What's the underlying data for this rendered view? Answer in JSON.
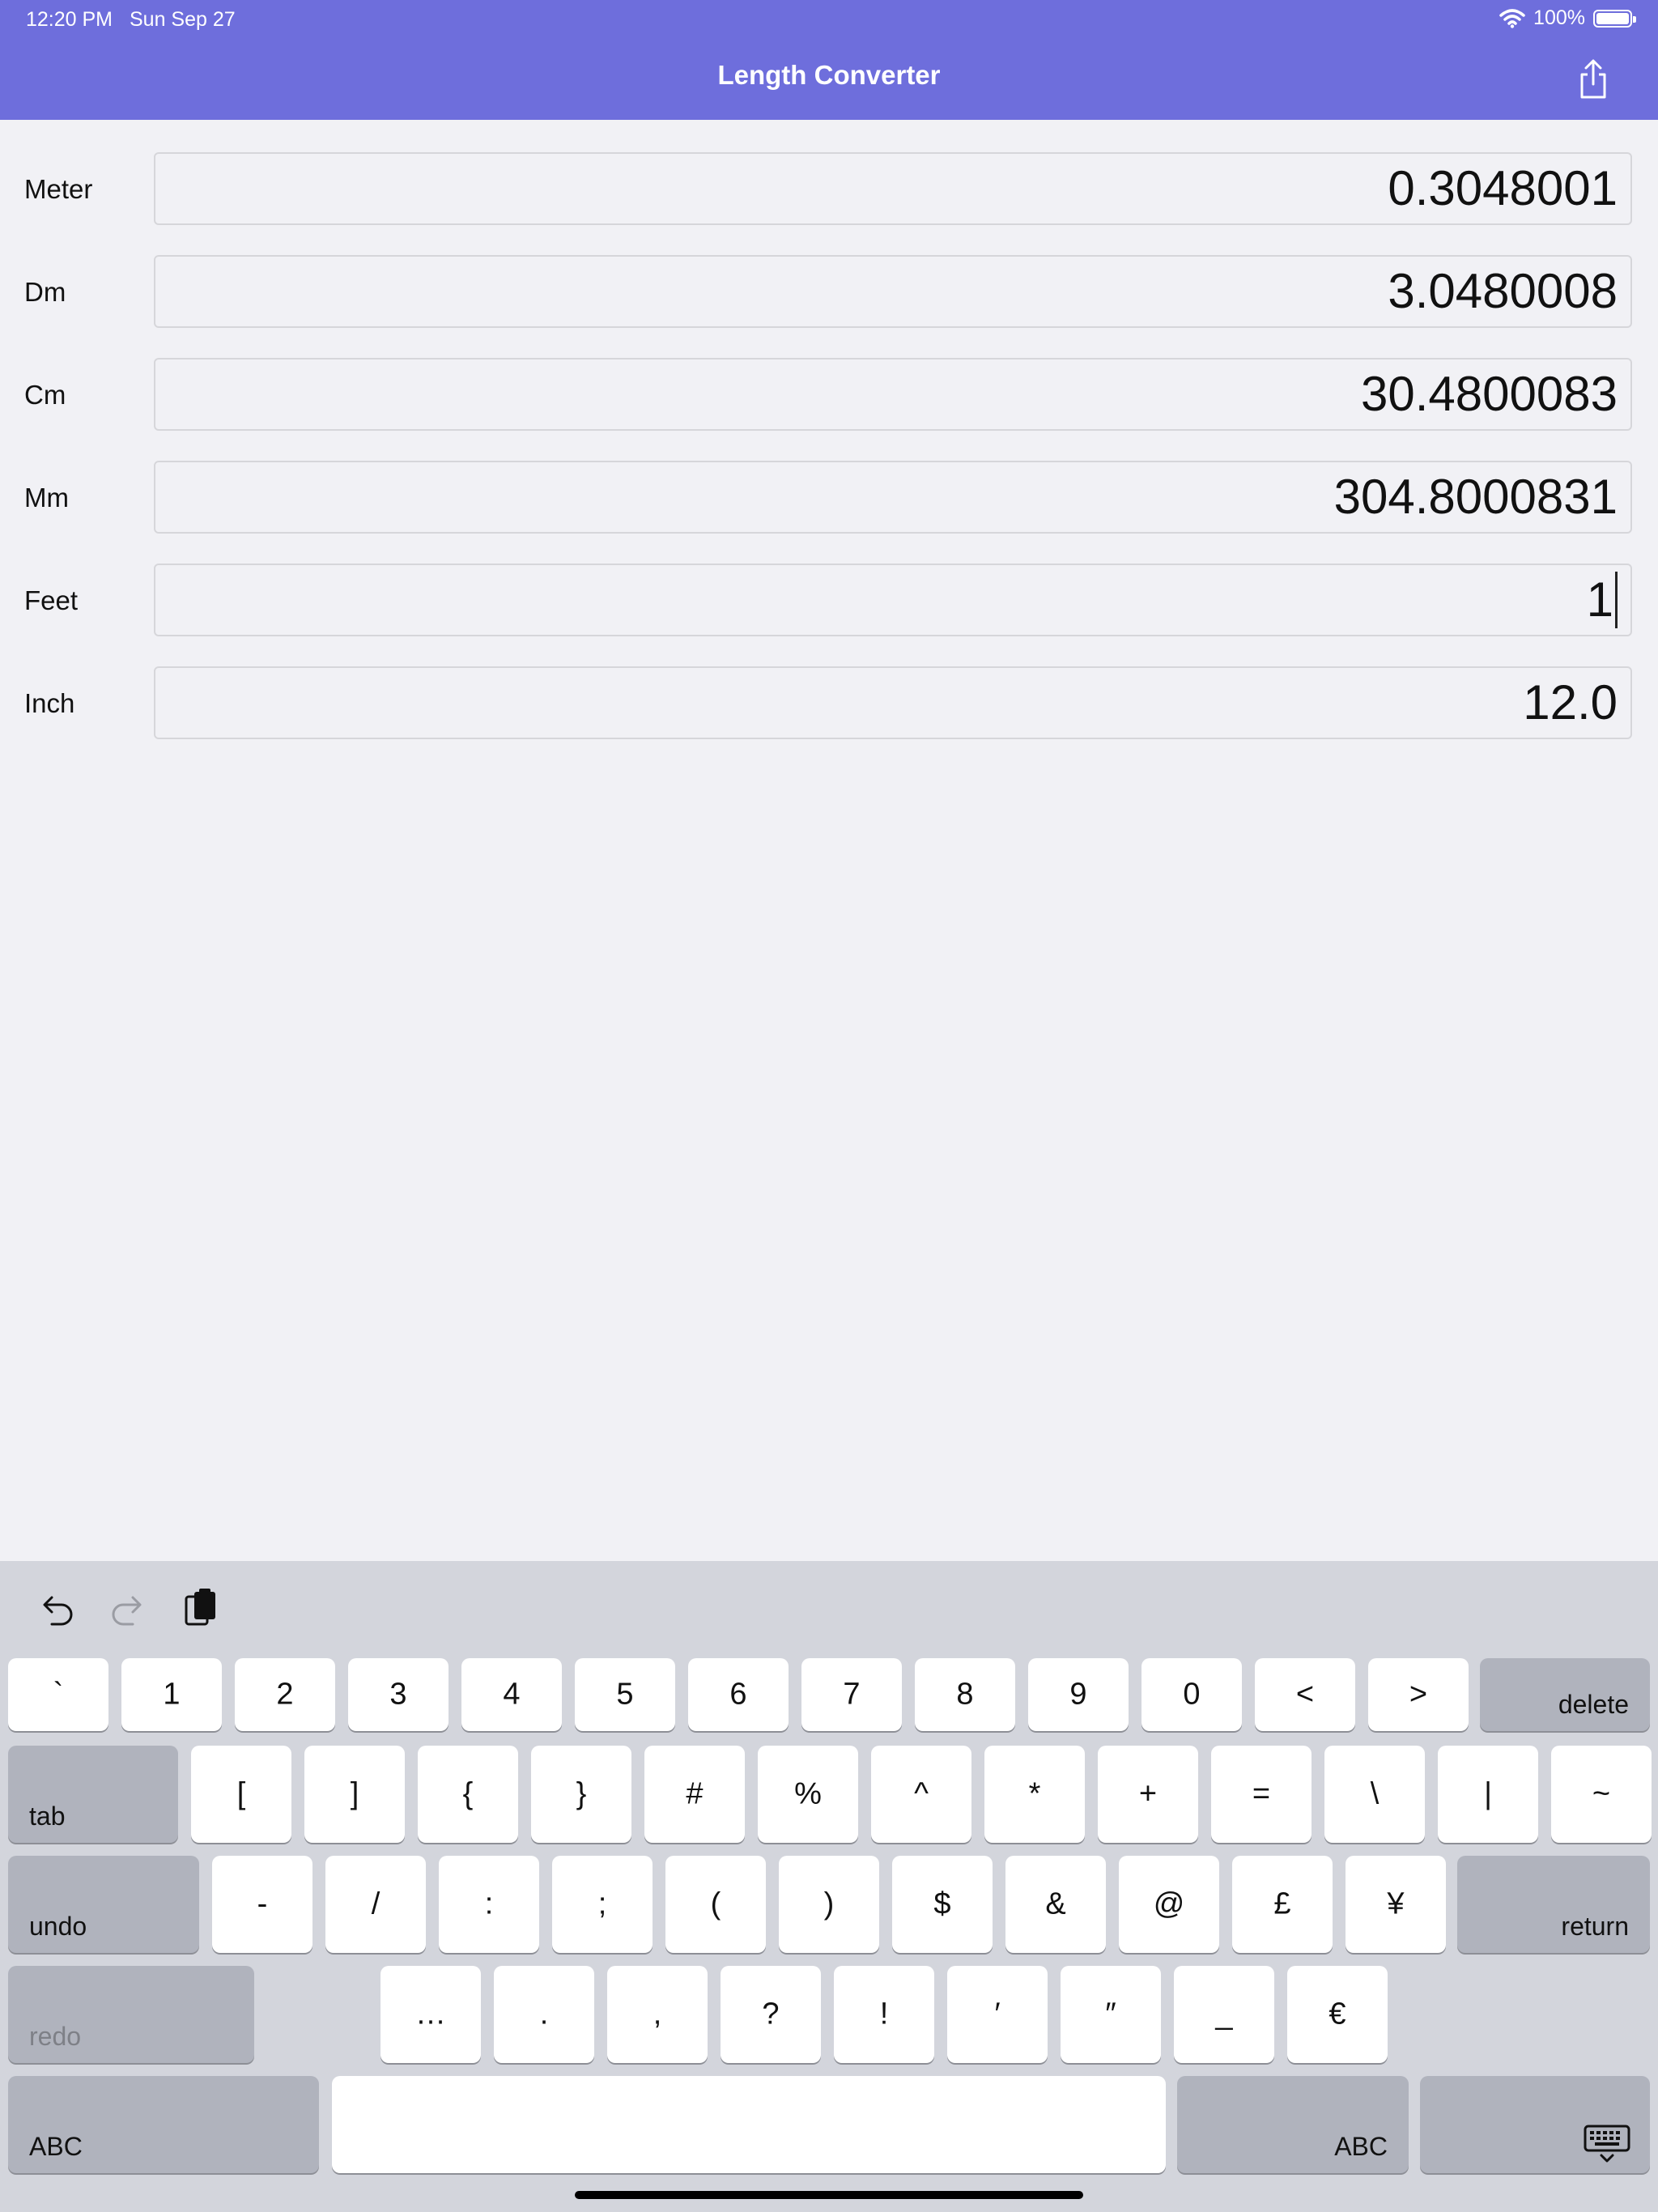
{
  "status_bar": {
    "time": "12:20 PM",
    "date": "Sun Sep 27",
    "battery_text": "100%",
    "battery_level": 1.0
  },
  "nav": {
    "title": "Length Converter",
    "action_icon": "share-icon"
  },
  "fields": [
    {
      "label": "Meter",
      "value": "0.3048001"
    },
    {
      "label": "Dm",
      "value": "3.0480008"
    },
    {
      "label": "Cm",
      "value": "30.4800083"
    },
    {
      "label": "Mm",
      "value": "304.8000831"
    },
    {
      "label": "Feet",
      "value": "1"
    },
    {
      "label": "Inch",
      "value": "12.0"
    }
  ],
  "keyboard": {
    "toolbar": [
      "undo-icon",
      "redo-icon",
      "paste-icon"
    ],
    "row1": [
      "`",
      "1",
      "2",
      "3",
      "4",
      "5",
      "6",
      "7",
      "8",
      "9",
      "0",
      "<",
      ">"
    ],
    "delete_label": "delete",
    "tab_label": "tab",
    "row2": [
      "[",
      "]",
      "{",
      "}",
      "#",
      "%",
      "^",
      "*",
      "+",
      "=",
      "\\",
      "|",
      "~"
    ],
    "undo_label": "undo",
    "row3": [
      "-",
      "/",
      ":",
      ";",
      "(",
      ")",
      "$",
      "&",
      "@",
      "£",
      "¥"
    ],
    "return_label": "return",
    "redo_label": "redo",
    "row4": [
      "…",
      ".",
      ",",
      "?",
      "!",
      "′",
      "″",
      "_",
      "€"
    ],
    "abc_left": "ABC",
    "abc_right": "ABC"
  },
  "colors": {
    "accent": "#6e6edc",
    "background": "#f1f1f5",
    "keyboard": "#d3d5dc"
  }
}
